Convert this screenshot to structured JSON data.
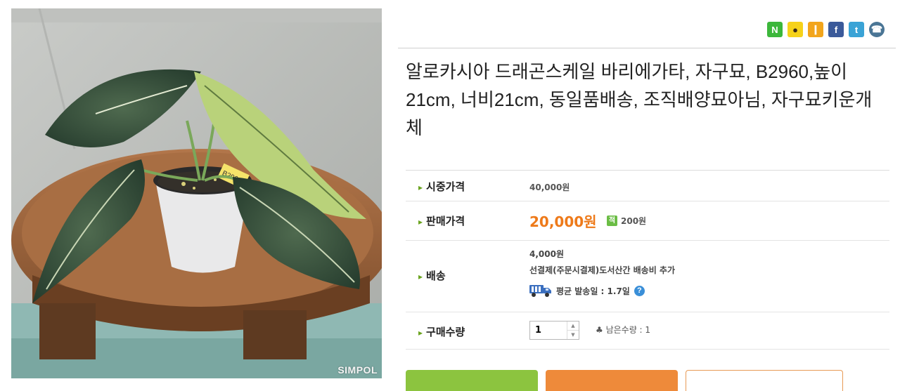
{
  "photo": {
    "alt_icon": "plant-photo",
    "watermark": "SIMPOL",
    "tag_text": "B2960"
  },
  "share_icons": [
    {
      "name": "naver-icon",
      "glyph": "N"
    },
    {
      "name": "kakaotalk-icon",
      "glyph": "●"
    },
    {
      "name": "kakaostory-icon",
      "glyph": "❙"
    },
    {
      "name": "facebook-icon",
      "glyph": "f"
    },
    {
      "name": "twitter-icon",
      "glyph": "t"
    },
    {
      "name": "phone-icon",
      "glyph": "☎"
    }
  ],
  "product": {
    "title": "알로카시아 드래곤스케일 바리에가타, 자구묘, B2960,높이 21cm, 너비21cm, 동일품배송, 조직배양묘아님, 자구묘키운개체"
  },
  "info": {
    "market_price_label": "시중가격",
    "market_price": "40,000원",
    "sale_price_label": "판매가격",
    "sale_price": "20,000원",
    "point_badge": "적",
    "point_value": "200원",
    "shipping_label": "배송",
    "shipping_fee": "4,000원",
    "shipping_note": "선결제(주문시결제)도서산간 배송비 추가",
    "avg_ship_label": "평균 발송일 : 1.7일",
    "help_glyph": "?",
    "qty_label": "구매수량",
    "qty_value": "1",
    "remain_text": "♣ 남은수량 : 1"
  },
  "colors": {
    "accent_green": "#8cc43f",
    "accent_orange": "#ee7a1a",
    "help_blue": "#3a8fd8"
  }
}
